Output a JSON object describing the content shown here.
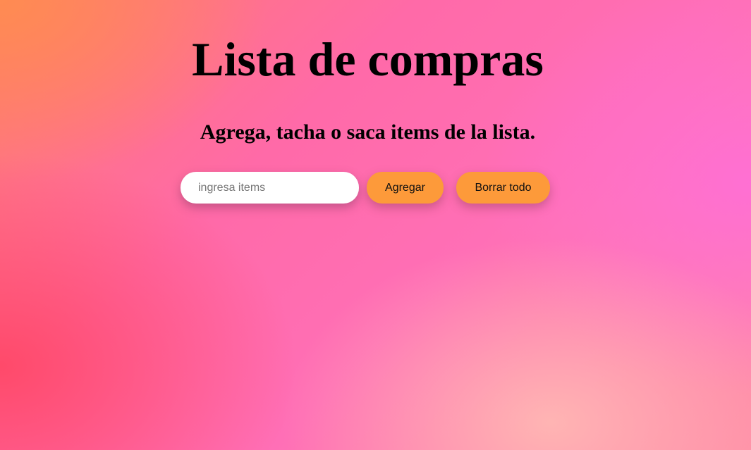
{
  "header": {
    "title": "Lista de compras",
    "subtitle": "Agrega, tacha o saca items de la lista."
  },
  "form": {
    "input_placeholder": "ingresa items",
    "input_value": "",
    "add_label": "Agregar",
    "clear_label": "Borrar todo"
  },
  "list": {
    "items": []
  },
  "colors": {
    "button": "#fd9a3a",
    "input_bg": "#ffffff",
    "text": "#000000"
  }
}
